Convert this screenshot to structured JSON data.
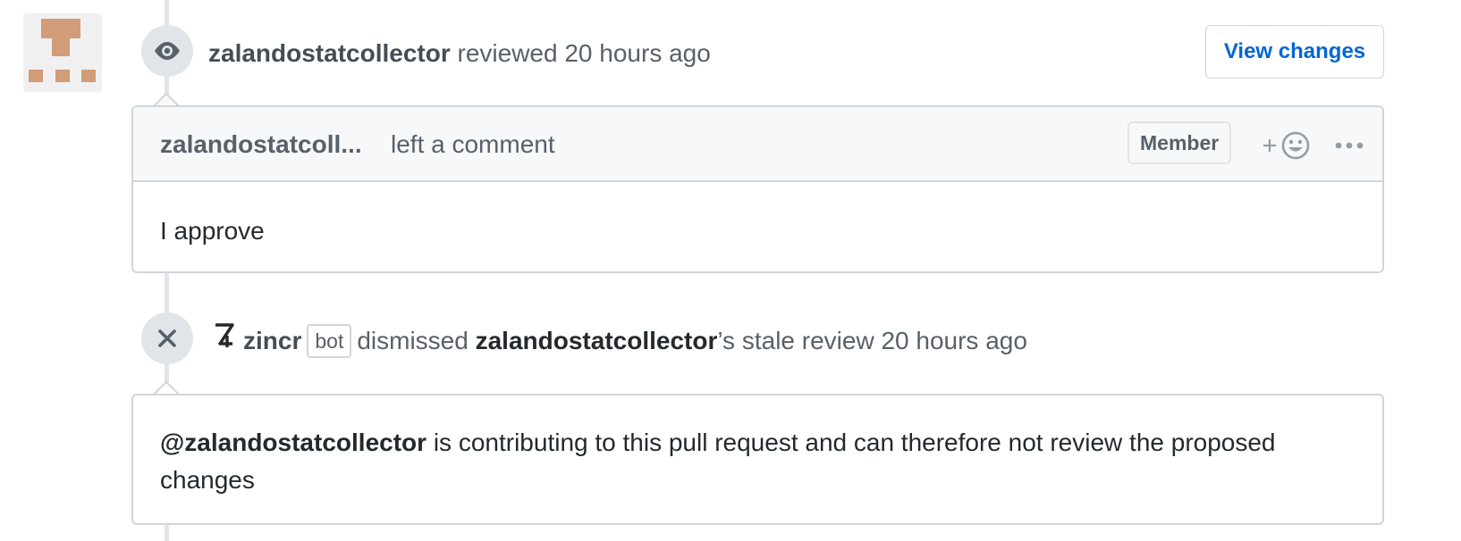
{
  "review_event": {
    "author": "zalandostatcollector",
    "action": "reviewed",
    "time": "20 hours ago",
    "view_changes_label": "View changes",
    "icon": "eye-icon"
  },
  "comment": {
    "author": "zalandostatcoll...",
    "action": "left a comment",
    "role_badge": "Member",
    "reaction_icon": "smiley-icon",
    "more_icon": "kebab-horizontal-icon",
    "body": "I approve"
  },
  "dismiss_event": {
    "icon": "x-icon",
    "actor": "zincr",
    "actor_badge": "bot",
    "action": "dismissed",
    "target": "zalandostatcollector",
    "suffix": "’s stale review",
    "time": "20 hours ago",
    "mention": "@zalandostatcollector",
    "message": " is contributing to this pull request and can therefore not review the proposed changes"
  },
  "colors": {
    "link": "#0366d6",
    "border": "#d1d5da",
    "header_bg": "#f6f8fa",
    "avatar_accent": "#d19c78"
  }
}
